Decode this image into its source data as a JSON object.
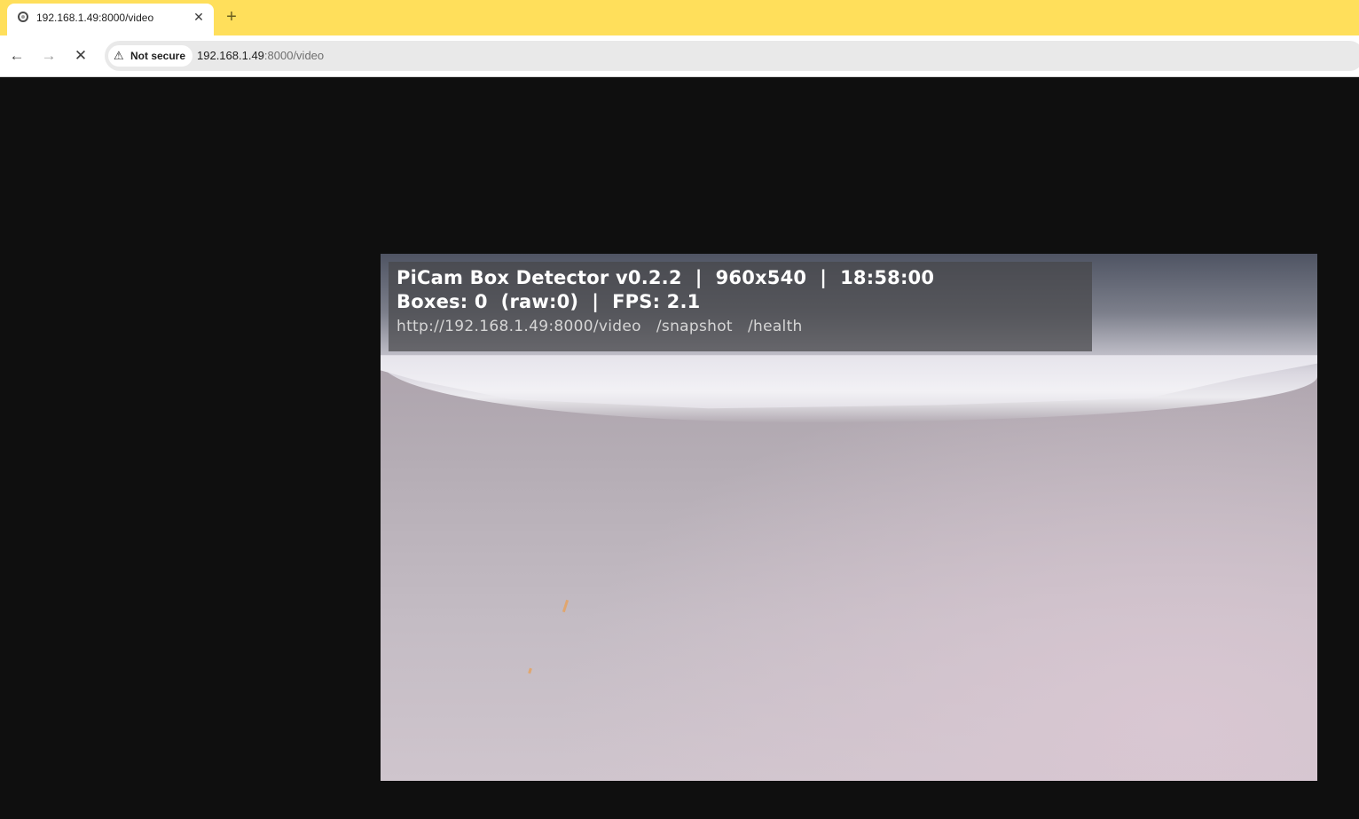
{
  "tab": {
    "title": "192.168.1.49:8000/video",
    "close_glyph": "✕",
    "favicon": "loading-spinner-icon"
  },
  "new_tab_glyph": "+",
  "toolbar": {
    "back_glyph": "←",
    "forward_glyph": "→",
    "stop_glyph": "✕",
    "security_label": "Not secure",
    "warning_glyph": "⚠",
    "url_host": "192.168.1.49",
    "url_path": ":8000/video"
  },
  "overlay": {
    "line1": "PiCam Box Detector v0.2.2  |  960x540  |  18:58:00",
    "line2": "Boxes: 0  (raw:0)  |  FPS: 2.1",
    "line3": "http://192.168.1.49:8000/video   /snapshot   /health"
  },
  "colors": {
    "tabstrip": "#ffdf5b",
    "page_background": "#0f0f0f"
  }
}
